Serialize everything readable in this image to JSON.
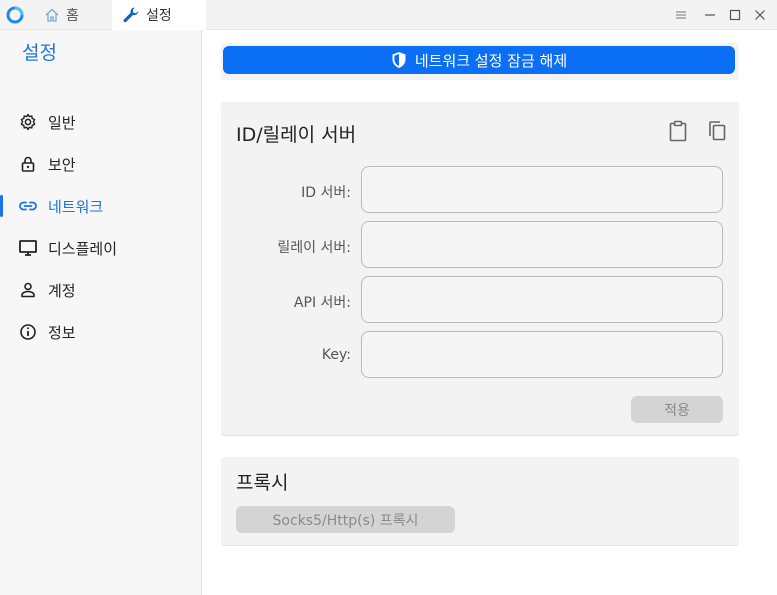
{
  "titlebar": {
    "tabs": [
      {
        "label": "홈",
        "icon": "home-icon"
      },
      {
        "label": "설정",
        "icon": "wrench-icon"
      }
    ],
    "accent": "#1a73e8"
  },
  "sidebar": {
    "title": "설정",
    "items": [
      {
        "label": "일반",
        "icon": "gear-icon"
      },
      {
        "label": "보안",
        "icon": "lock-icon"
      },
      {
        "label": "네트워크",
        "icon": "link-icon",
        "active": true
      },
      {
        "label": "디스플레이",
        "icon": "monitor-icon"
      },
      {
        "label": "계정",
        "icon": "person-icon"
      },
      {
        "label": "정보",
        "icon": "info-icon"
      }
    ]
  },
  "main": {
    "unlock_label": "네트워크 설정 잠금 해제",
    "server_card": {
      "title": "ID/릴레이 서버",
      "fields": [
        {
          "label": "ID 서버:",
          "value": ""
        },
        {
          "label": "릴레이 서버:",
          "value": ""
        },
        {
          "label": "API 서버:",
          "value": ""
        },
        {
          "label": "Key:",
          "value": ""
        }
      ],
      "apply_label": "적용"
    },
    "proxy_card": {
      "title": "프록시",
      "button_label": "Socks5/Http(s) 프록시"
    }
  },
  "colors": {
    "primary_button": "#0a6ff5",
    "sidebar_active": "#1a73e8",
    "disabled_button": "#d4d4d4"
  }
}
